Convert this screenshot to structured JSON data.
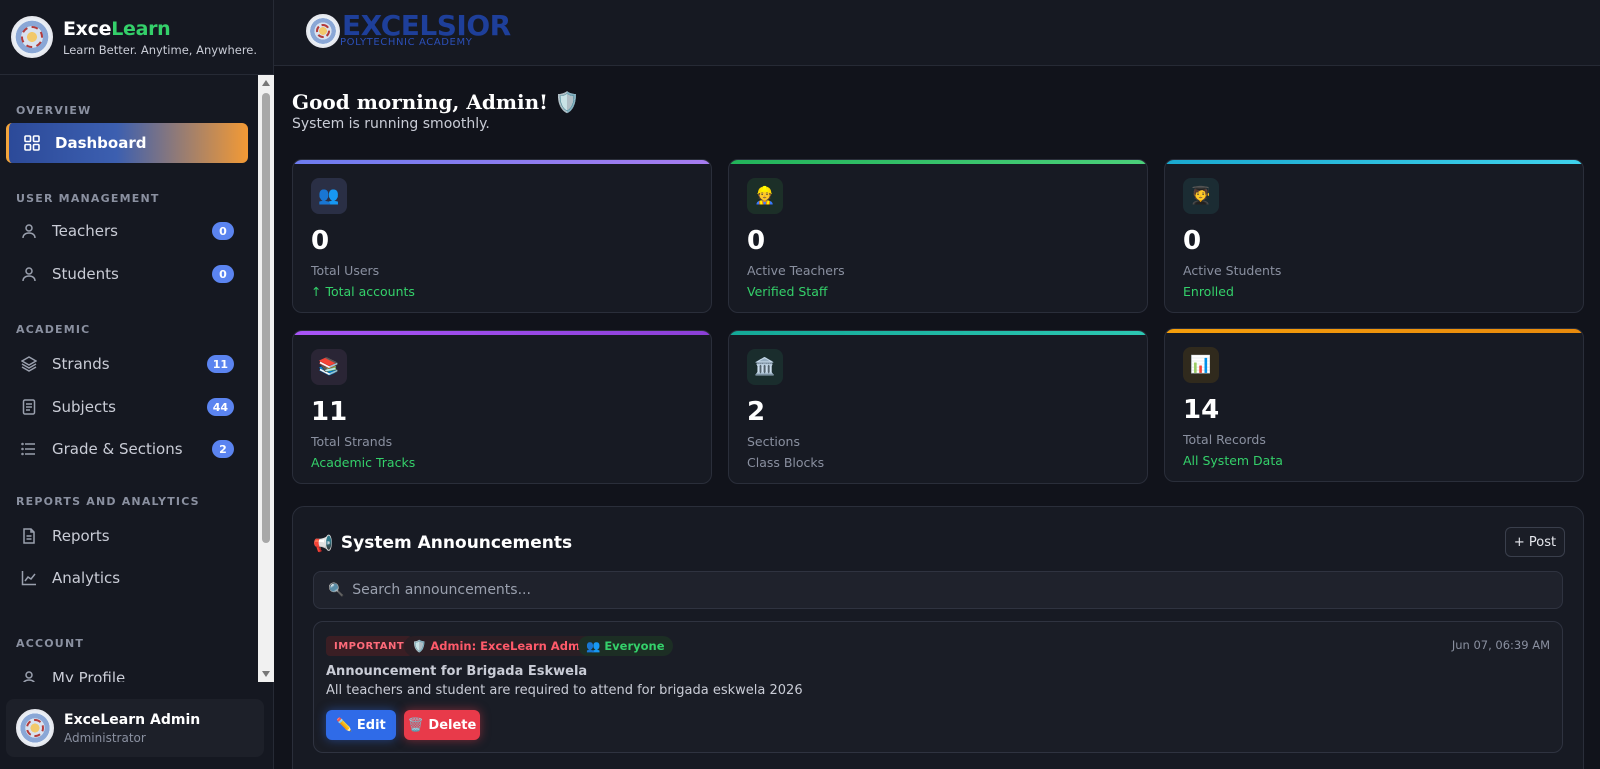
{
  "brand": {
    "name_main": "Exce",
    "name_accent": "Learn",
    "tagline": "Learn Better. Anytime, Anywhere."
  },
  "sidebar": {
    "sections": [
      "OVERVIEW",
      "USER MANAGEMENT",
      "ACADEMIC",
      "REPORTS AND ANALYTICS",
      "ACCOUNT"
    ],
    "items": [
      {
        "label": "Dashboard",
        "icon": "grid-icon",
        "active": true
      },
      {
        "label": "Teachers",
        "icon": "user-icon",
        "badge": "0"
      },
      {
        "label": "Students",
        "icon": "user-icon",
        "badge": "0"
      },
      {
        "label": "Strands",
        "icon": "layers-icon",
        "badge": "11"
      },
      {
        "label": "Subjects",
        "icon": "book-icon",
        "badge": "44"
      },
      {
        "label": "Grade & Sections",
        "icon": "list-icon",
        "badge": "2"
      },
      {
        "label": "Reports",
        "icon": "document-icon"
      },
      {
        "label": "Analytics",
        "icon": "chart-line-icon"
      },
      {
        "label": "My Profile",
        "icon": "user-icon"
      }
    ]
  },
  "user": {
    "name": "ExceLearn Admin",
    "role": "Administrator"
  },
  "topbar": {
    "school_name": "EXCELSIOR",
    "school_sub": "POLYTECHNIC ACADEMY"
  },
  "greeting": {
    "title": "Good morning, Admin! 🛡️",
    "subtitle": "System is running smoothly."
  },
  "stats": [
    {
      "value": "0",
      "label": "Total Users",
      "sub": "↑ Total accounts",
      "icon": "👥",
      "accent": "#8b7cf6"
    },
    {
      "value": "0",
      "label": "Active Teachers",
      "sub": "Verified Staff",
      "icon": "👷",
      "accent": "#34d06a"
    },
    {
      "value": "0",
      "label": "Active Students",
      "sub": "Enrolled",
      "icon": "🧑‍🎓",
      "accent": "#22c3e6"
    },
    {
      "value": "11",
      "label": "Total Strands",
      "sub": "Academic Tracks",
      "icon": "📚",
      "accent": "#a855f7"
    },
    {
      "value": "2",
      "label": "Sections",
      "sub": "Class Blocks",
      "icon": "🏛️",
      "accent": "#14b8a6"
    },
    {
      "value": "14",
      "label": "Total Records",
      "sub": "All System Data",
      "icon": "📊",
      "accent": "#f59e0b"
    }
  ],
  "announcements": {
    "title": "System Announcements",
    "post_button": "+ Post",
    "search_placeholder": "Search announcements...",
    "items": [
      {
        "tag_important": "IMPORTANT",
        "tag_author": "🛡️ Admin: ExceLearn Admin",
        "tag_audience": "👥 Everyone",
        "date": "Jun 07, 06:39 AM",
        "title": "Announcement for Brigada Eskwela",
        "body": "All teachers and student are required to attend for brigada eskwela 2026",
        "edit_label": "✏️ Edit",
        "delete_label": "🗑️ Delete"
      }
    ]
  }
}
